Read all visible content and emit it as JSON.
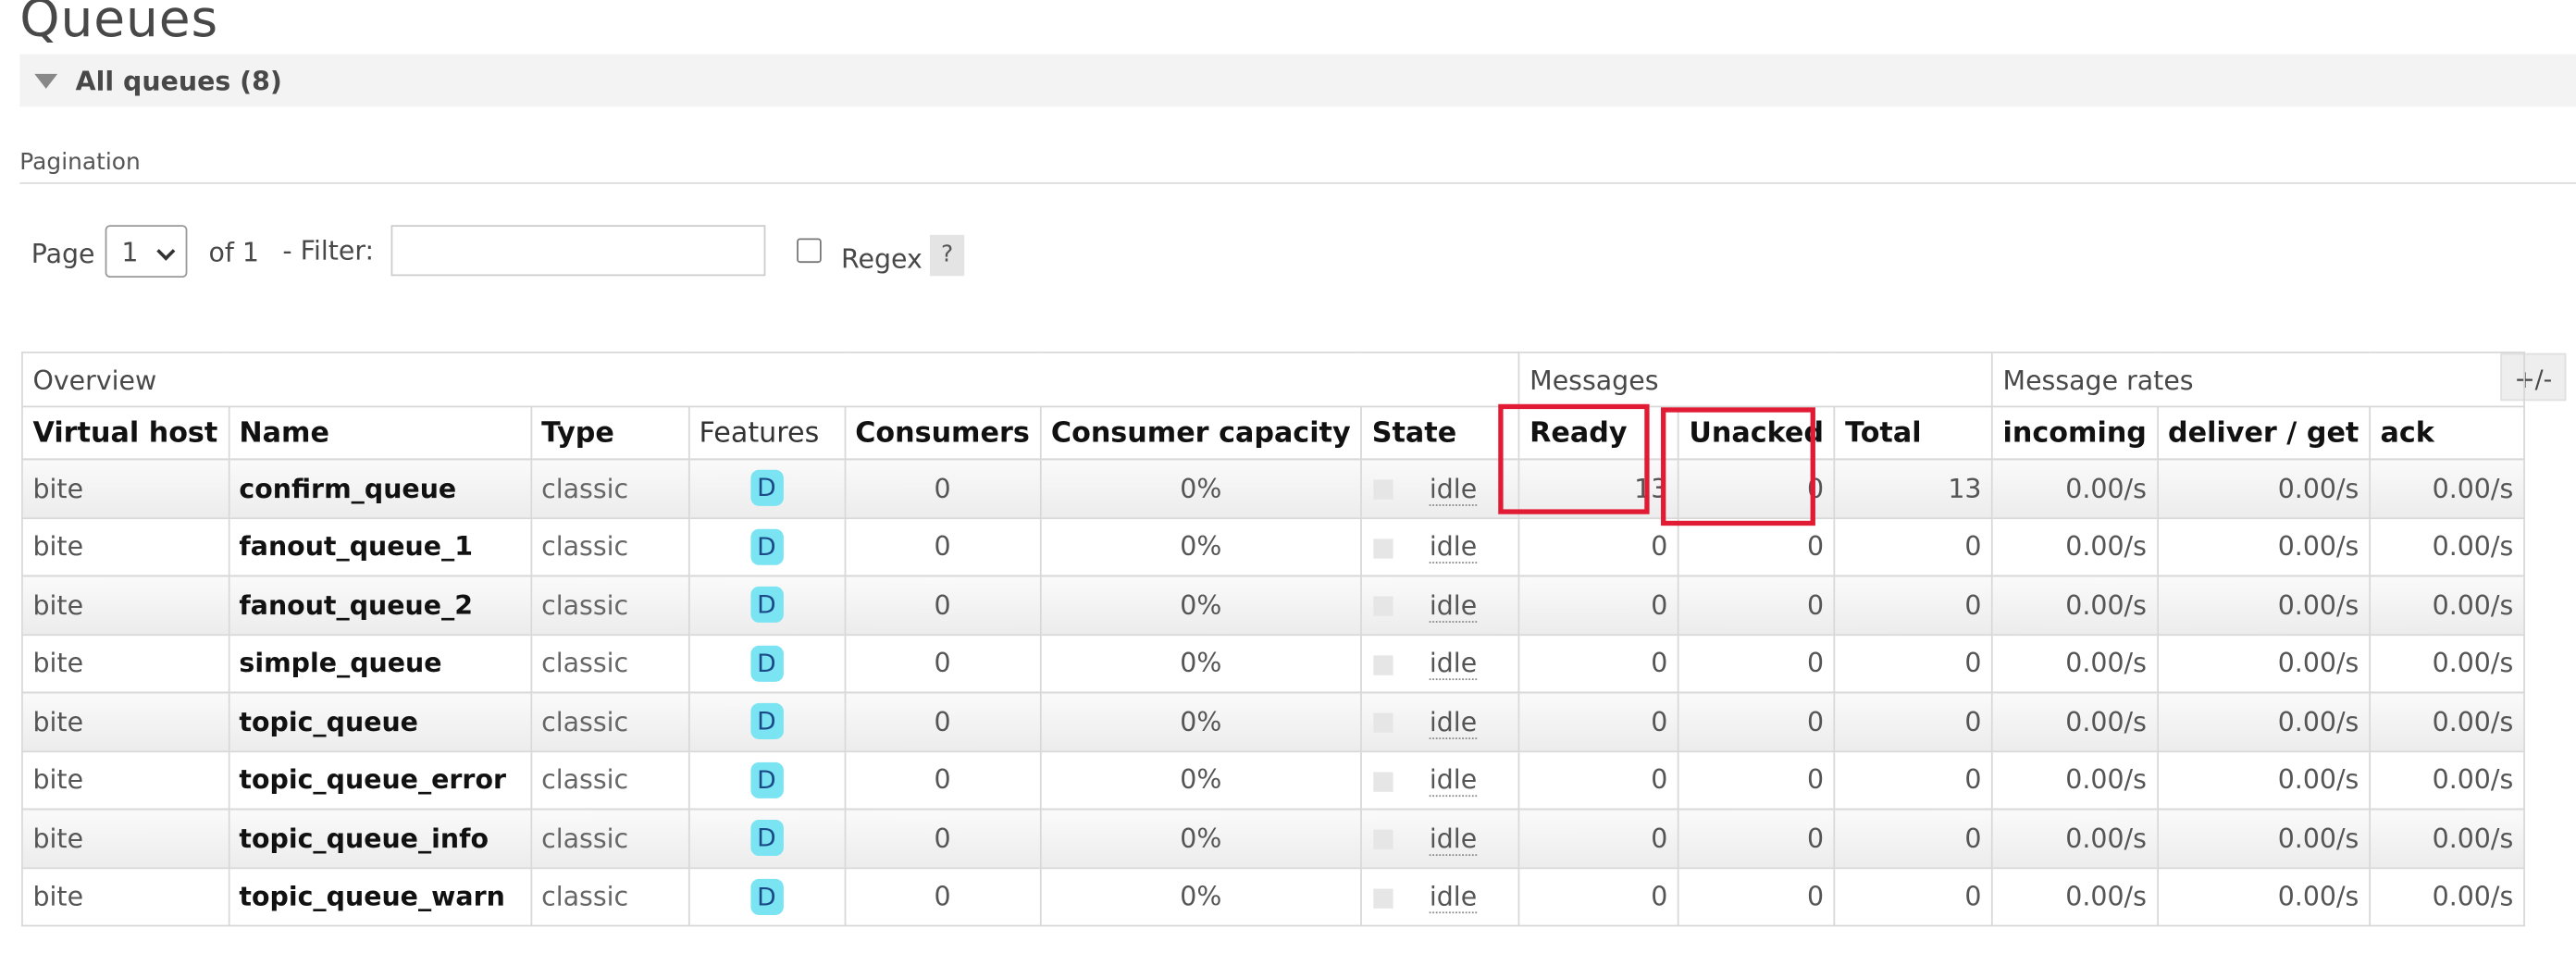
{
  "page": {
    "title": "Queues"
  },
  "section": {
    "label": "All queues (8)"
  },
  "pagination": {
    "label": "Pagination",
    "page_label": "Page",
    "page_value": "1",
    "of_label": "of 1",
    "filter_label": "- Filter:",
    "filter_value": "",
    "regex_label": "Regex",
    "help_label": "?"
  },
  "table": {
    "toggle_label": "+/-",
    "groups": {
      "overview": "Overview",
      "messages": "Messages",
      "message_rates": "Message rates"
    },
    "columns": {
      "virtual_host": "Virtual host",
      "name": "Name",
      "type": "Type",
      "features": "Features",
      "consumers": "Consumers",
      "consumer_capacity": "Consumer capacity",
      "state": "State",
      "ready": "Ready",
      "unacked": "Unacked",
      "total": "Total",
      "incoming": "incoming",
      "deliver_get": "deliver / get",
      "ack": "ack"
    },
    "rows": [
      {
        "vhost": "bite",
        "name": "confirm_queue",
        "type": "classic",
        "feature": "D",
        "consumers": "0",
        "capacity": "0%",
        "state": "idle",
        "ready": "13",
        "unacked": "0",
        "total": "13",
        "incoming": "0.00/s",
        "deliver_get": "0.00/s",
        "ack": "0.00/s"
      },
      {
        "vhost": "bite",
        "name": "fanout_queue_1",
        "type": "classic",
        "feature": "D",
        "consumers": "0",
        "capacity": "0%",
        "state": "idle",
        "ready": "0",
        "unacked": "0",
        "total": "0",
        "incoming": "0.00/s",
        "deliver_get": "0.00/s",
        "ack": "0.00/s"
      },
      {
        "vhost": "bite",
        "name": "fanout_queue_2",
        "type": "classic",
        "feature": "D",
        "consumers": "0",
        "capacity": "0%",
        "state": "idle",
        "ready": "0",
        "unacked": "0",
        "total": "0",
        "incoming": "0.00/s",
        "deliver_get": "0.00/s",
        "ack": "0.00/s"
      },
      {
        "vhost": "bite",
        "name": "simple_queue",
        "type": "classic",
        "feature": "D",
        "consumers": "0",
        "capacity": "0%",
        "state": "idle",
        "ready": "0",
        "unacked": "0",
        "total": "0",
        "incoming": "0.00/s",
        "deliver_get": "0.00/s",
        "ack": "0.00/s"
      },
      {
        "vhost": "bite",
        "name": "topic_queue",
        "type": "classic",
        "feature": "D",
        "consumers": "0",
        "capacity": "0%",
        "state": "idle",
        "ready": "0",
        "unacked": "0",
        "total": "0",
        "incoming": "0.00/s",
        "deliver_get": "0.00/s",
        "ack": "0.00/s"
      },
      {
        "vhost": "bite",
        "name": "topic_queue_error",
        "type": "classic",
        "feature": "D",
        "consumers": "0",
        "capacity": "0%",
        "state": "idle",
        "ready": "0",
        "unacked": "0",
        "total": "0",
        "incoming": "0.00/s",
        "deliver_get": "0.00/s",
        "ack": "0.00/s"
      },
      {
        "vhost": "bite",
        "name": "topic_queue_info",
        "type": "classic",
        "feature": "D",
        "consumers": "0",
        "capacity": "0%",
        "state": "idle",
        "ready": "0",
        "unacked": "0",
        "total": "0",
        "incoming": "0.00/s",
        "deliver_get": "0.00/s",
        "ack": "0.00/s"
      },
      {
        "vhost": "bite",
        "name": "topic_queue_warn",
        "type": "classic",
        "feature": "D",
        "consumers": "0",
        "capacity": "0%",
        "state": "idle",
        "ready": "0",
        "unacked": "0",
        "total": "0",
        "incoming": "0.00/s",
        "deliver_get": "0.00/s",
        "ack": "0.00/s"
      }
    ]
  },
  "colors": {
    "highlight": "#e11b34",
    "feature_badge": "#7be4f3"
  }
}
